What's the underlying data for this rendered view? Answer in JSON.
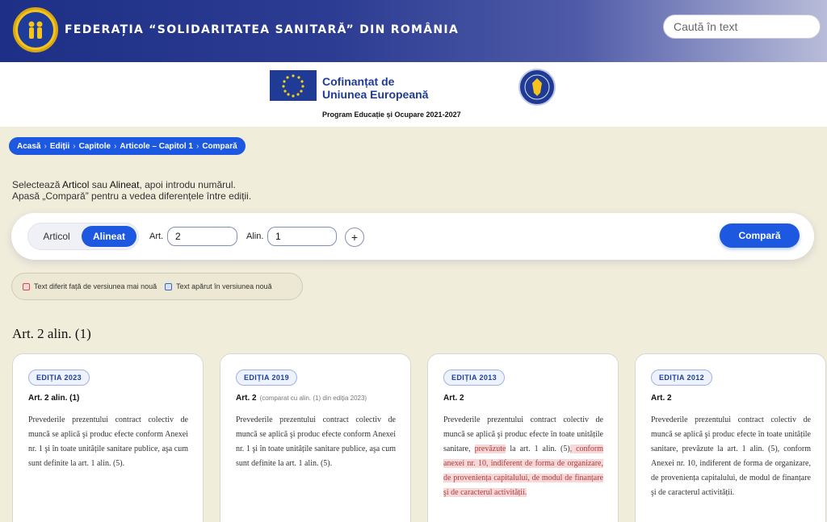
{
  "header": {
    "title": "FEDERAȚIA “SOLIDARITATEA SANITARĂ” DIN ROMÂNIA",
    "search_placeholder": "Caută în text"
  },
  "sponsor": {
    "eu_line1": "Cofinanțat de",
    "eu_line2": "Uniunea Europeană",
    "program": "Program Educație și Ocupare 2021-2027"
  },
  "breadcrumb": [
    "Acasă",
    "Ediții",
    "Capitole",
    "Articole – Capitol 1",
    "Compară"
  ],
  "instructions": {
    "line1_pre": "Selectează ",
    "line1_art": "Articol",
    "line1_mid": " sau ",
    "line1_alin": "Alineat",
    "line1_post": ", apoi introdu numărul.",
    "line2": "Apasă „Compară” pentru a vedea diferențele între ediții."
  },
  "controls": {
    "toggle_articol": "Articol",
    "toggle_alineat": "Alineat",
    "art_label": "Art.",
    "art_value": "2",
    "alin_label": "Alin.",
    "alin_value": "1",
    "plus": "+",
    "compare": "Compară"
  },
  "legend": {
    "diff_text": "Text diferit față de versiunea mai nouă",
    "new_text": "Text apărut în versiunea nouă"
  },
  "section_title": "Art. 2 alin. (1)",
  "cards": [
    {
      "badge": "EDIȚIA 2023",
      "head": "Art. 2  alin. (1)",
      "note": "",
      "body": "Prevederile prezentului contract colectiv de muncă se aplică şi produc efecte conform Anexei nr. 1 şi în toate unitățile sanitare publice, aşa cum sunt definite la art. 1 alin. (5)."
    },
    {
      "badge": "EDIȚIA 2019",
      "head": "Art. 2",
      "note": "(comparat cu alin. (1) din ediția 2023)",
      "body": "Prevederile prezentului contract colectiv de muncă se aplică şi produc efecte conform Anexei nr. 1 şi în toate unitățile sanitare publice, aşa cum sunt definite la art. 1 alin. (5)."
    },
    {
      "badge": "EDIȚIA 2013",
      "head": "Art. 2",
      "note": "",
      "body_a": "Prevederile prezentului contract colectiv de muncă se aplică şi produc efecte în toate unitățile sanitare, ",
      "body_d1": "prevăzute",
      "body_b": " la art. 1 alin. (5)",
      "body_d2": ", conform anexei nr. 10, indiferent de forma de organizare, de proveniența capitalului, de modul de finanțare şi de caracterul activității.",
      "body_c": ""
    },
    {
      "badge": "EDIȚIA 2012",
      "head": "Art. 2",
      "note": "",
      "body": "Prevederile prezentului contract colectiv de muncă se aplică şi produc efecte în toate unitățile sanitare, prevăzute la art. 1 alin. (5), conform Anexei nr. 10, indiferent de forma de organizare, de proveniența capitalului, de modul de finanțare şi de caracterul activității."
    }
  ]
}
